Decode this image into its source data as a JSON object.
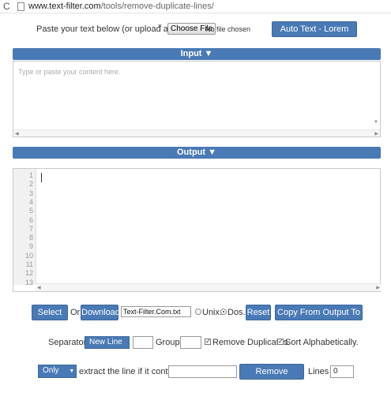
{
  "browser": {
    "reload_icon": "reload-icon",
    "url_host": "www.text-filter.com",
    "url_path": "/tools/remove-duplicate-lines/"
  },
  "upload": {
    "label": "Paste your text below (or upload a file)",
    "choose_file": "Choose File",
    "no_file": "No file chosen",
    "lorem_button": "Auto Text - Lorem Ipsum"
  },
  "input": {
    "header": "Input ▼",
    "placeholder": "Type or paste your content here."
  },
  "output": {
    "header": "Output ▼",
    "line_numbers": [
      "1",
      "2",
      "3",
      "4",
      "5",
      "6",
      "7",
      "8",
      "9",
      "10",
      "11",
      "12",
      "13"
    ]
  },
  "actions": {
    "select_all": "Select All",
    "or": "Or",
    "download": "Download",
    "filename": "Text-Filter.Com.txt",
    "unix": "Unix.",
    "dos": "Dos.",
    "selected_format": "Dos.",
    "reset": "Reset",
    "copy_output": "Copy From Output To Input"
  },
  "options": {
    "separator_label": "Separator:",
    "separator_value": "New Line",
    "group_label": "Group:",
    "remove_duplicates_label": "Remove Duplicates.",
    "remove_duplicates_checked": true,
    "sort_label": "Sort Alphabetically.",
    "sort_checked": true
  },
  "filter": {
    "mode": "Only",
    "extract_label": "extract the line if it contains:",
    "remove_button": "Remove Duplicates",
    "lines_label": "Lines :",
    "lines_count": "0"
  },
  "colors": {
    "accent": "#4a7ab5"
  }
}
